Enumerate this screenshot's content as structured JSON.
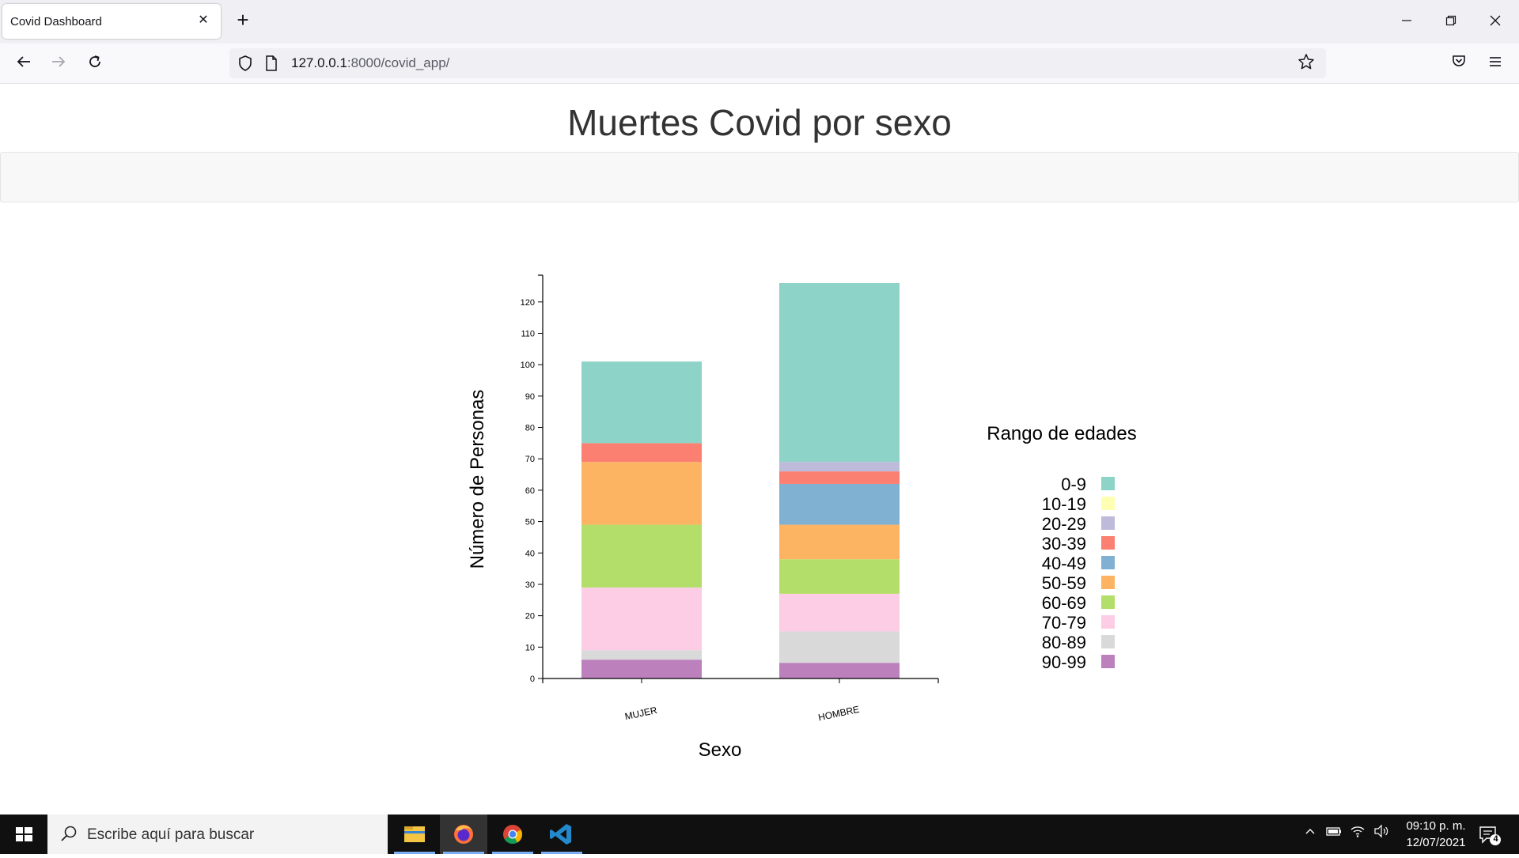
{
  "browser": {
    "tab_title": "Covid Dashboard",
    "url_host": "127.0.0.1",
    "url_rest": ":8000/covid_app/"
  },
  "page": {
    "title": "Muertes Covid por sexo"
  },
  "chart_data": {
    "type": "bar",
    "stacked": true,
    "categories": [
      "MUJER",
      "HOMBRE"
    ],
    "xlabel": "Sexo",
    "ylabel": "Número de Personas",
    "ylim": [
      0,
      126
    ],
    "yticks": [
      0,
      10,
      20,
      30,
      40,
      50,
      60,
      70,
      80,
      90,
      100,
      110,
      120
    ],
    "legend_title": "Rango de edades",
    "legend_position": "right",
    "grid": false,
    "series": [
      {
        "name": "90-99",
        "color": "#bc80bd",
        "values": [
          6,
          5
        ]
      },
      {
        "name": "80-89",
        "color": "#d9d9d9",
        "values": [
          3,
          10
        ]
      },
      {
        "name": "70-79",
        "color": "#fccde5",
        "values": [
          20,
          12
        ]
      },
      {
        "name": "60-69",
        "color": "#b3de69",
        "values": [
          20,
          11
        ]
      },
      {
        "name": "50-59",
        "color": "#fdb462",
        "values": [
          20,
          11
        ]
      },
      {
        "name": "40-49",
        "color": "#80b1d3",
        "values": [
          0,
          13
        ]
      },
      {
        "name": "30-39",
        "color": "#fb8072",
        "values": [
          6,
          4
        ]
      },
      {
        "name": "20-29",
        "color": "#bebada",
        "values": [
          0,
          3
        ]
      },
      {
        "name": "10-19",
        "color": "#ffffb3",
        "values": [
          0,
          0
        ]
      },
      {
        "name": "0-9",
        "color": "#8dd3c7",
        "values": [
          26,
          57
        ]
      }
    ],
    "legend_order": [
      "0-9",
      "10-19",
      "20-29",
      "30-39",
      "40-49",
      "50-59",
      "60-69",
      "70-79",
      "80-89",
      "90-99"
    ]
  },
  "taskbar": {
    "search_placeholder": "Escribe aquí para buscar",
    "time": "09:10 p. m.",
    "date": "12/07/2021",
    "notification_count": "4"
  }
}
